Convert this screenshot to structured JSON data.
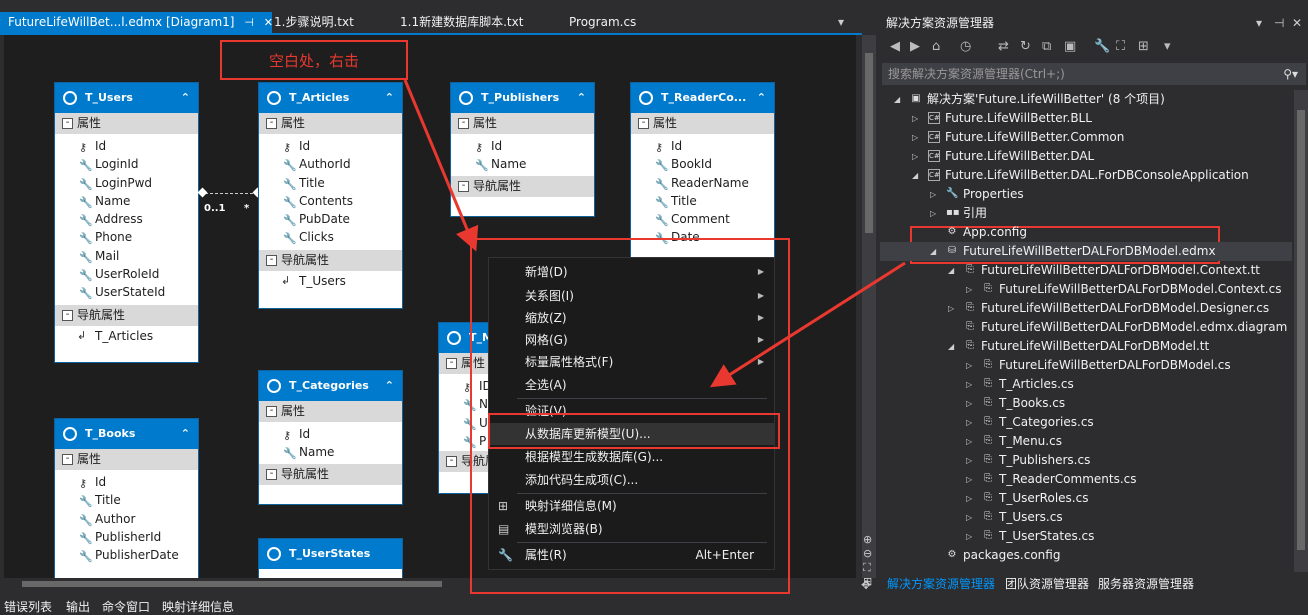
{
  "tabs": [
    {
      "label": "FutureLifeWillBet...l.edmx [Diagram1]",
      "active": true
    },
    {
      "label": "1.步骤说明.txt"
    },
    {
      "label": "1.1新建数据库脚本.txt"
    },
    {
      "label": "Program.cs"
    }
  ],
  "annotation": {
    "note": "空白处，右击"
  },
  "entities": {
    "users": {
      "title": "T_Users",
      "section_props": "属性",
      "section_nav": "导航属性",
      "props": [
        "Id",
        "LoginId",
        "LoginPwd",
        "Name",
        "Address",
        "Phone",
        "Mail",
        "UserRoleId",
        "UserStateId"
      ],
      "nav": [
        "T_Articles"
      ]
    },
    "articles": {
      "title": "T_Articles",
      "section_props": "属性",
      "section_nav": "导航属性",
      "props": [
        "Id",
        "AuthorId",
        "Title",
        "Contents",
        "PubDate",
        "Clicks"
      ],
      "nav": [
        "T_Users"
      ]
    },
    "publishers": {
      "title": "T_Publishers",
      "section_props": "属性",
      "section_nav": "导航属性",
      "props": [
        "Id",
        "Name"
      ]
    },
    "readercomments": {
      "title": "T_ReaderCo...",
      "section_props": "属性",
      "props": [
        "Id",
        "BookId",
        "ReaderName",
        "Title",
        "Comment",
        "Date"
      ]
    },
    "categories": {
      "title": "T_Categories",
      "section_props": "属性",
      "section_nav": "导航属性",
      "props": [
        "Id",
        "Name"
      ]
    },
    "books": {
      "title": "T_Books",
      "section_props": "属性",
      "props": [
        "Id",
        "Title",
        "Author",
        "PublisherId",
        "PublisherDate"
      ]
    },
    "userstates": {
      "title": "T_UserStates"
    },
    "menu": {
      "title": "T_M",
      "section_props": "属性",
      "section_nav": "导航属",
      "props": [
        "ID",
        "N",
        "U",
        "P"
      ]
    }
  },
  "association": {
    "left": "0..1",
    "right": "*"
  },
  "context_menu": {
    "items": [
      {
        "label": "新增(D)",
        "submenu": true
      },
      {
        "label": "关系图(I)",
        "submenu": true
      },
      {
        "label": "缩放(Z)",
        "submenu": true
      },
      {
        "label": "网格(G)",
        "submenu": true
      },
      {
        "label": "标量属性格式(F)",
        "submenu": true
      },
      {
        "label": "全选(A)"
      },
      {
        "label": "验证(V)"
      },
      {
        "label": "从数据库更新模型(U)...",
        "highlighted": true
      },
      {
        "label": "根据模型生成数据库(G)..."
      },
      {
        "label": "添加代码生成项(C)..."
      },
      {
        "label": "映射详细信息(M)",
        "icon": "mapping-icon"
      },
      {
        "label": "模型浏览器(B)",
        "icon": "model-browser-icon"
      },
      {
        "label": "属性(R)",
        "icon": "wrench-icon",
        "shortcut": "Alt+Enter"
      }
    ]
  },
  "solution_explorer": {
    "title": "解决方案资源管理器",
    "search_placeholder": "搜索解决方案资源管理器(Ctrl+;)",
    "tree": [
      {
        "label": "解决方案'Future.LifeWillBetter' (8 个项目)",
        "level": 0,
        "expand": "down"
      },
      {
        "label": "Future.LifeWillBetter.BLL",
        "level": 1,
        "expand": "right",
        "icon": "cs"
      },
      {
        "label": "Future.LifeWillBetter.Common",
        "level": 1,
        "expand": "right",
        "icon": "cs"
      },
      {
        "label": "Future.LifeWillBetter.DAL",
        "level": 1,
        "expand": "right",
        "icon": "cs"
      },
      {
        "label": "Future.LifeWillBetter.DAL.ForDBConsoleApplication",
        "level": 1,
        "expand": "down",
        "icon": "cs"
      },
      {
        "label": "Properties",
        "level": 2,
        "expand": "right",
        "icon": "wrench"
      },
      {
        "label": "引用",
        "level": 2,
        "expand": "right",
        "icon": "ref"
      },
      {
        "label": "App.config",
        "level": 2,
        "icon": "config"
      },
      {
        "label": "FutureLifeWillBetterDALForDBModel.edmx",
        "level": 2,
        "expand": "down",
        "icon": "edmx",
        "selected": true
      },
      {
        "label": "FutureLifeWillBetterDALForDBModel.Context.tt",
        "level": 3,
        "expand": "down",
        "icon": "file"
      },
      {
        "label": "FutureLifeWillBetterDALForDBModel.Context.cs",
        "level": 4,
        "expand": "right",
        "icon": "file"
      },
      {
        "label": "FutureLifeWillBetterDALForDBModel.Designer.cs",
        "level": 3,
        "expand": "right",
        "icon": "file"
      },
      {
        "label": "FutureLifeWillBetterDALForDBModel.edmx.diagram",
        "level": 3,
        "icon": "file"
      },
      {
        "label": "FutureLifeWillBetterDALForDBModel.tt",
        "level": 3,
        "expand": "down",
        "icon": "file"
      },
      {
        "label": "FutureLifeWillBetterDALForDBModel.cs",
        "level": 4,
        "expand": "right",
        "icon": "file"
      },
      {
        "label": "T_Articles.cs",
        "level": 4,
        "expand": "right",
        "icon": "file"
      },
      {
        "label": "T_Books.cs",
        "level": 4,
        "expand": "right",
        "icon": "file"
      },
      {
        "label": "T_Categories.cs",
        "level": 4,
        "expand": "right",
        "icon": "file"
      },
      {
        "label": "T_Menu.cs",
        "level": 4,
        "expand": "right",
        "icon": "file"
      },
      {
        "label": "T_Publishers.cs",
        "level": 4,
        "expand": "right",
        "icon": "file"
      },
      {
        "label": "T_ReaderComments.cs",
        "level": 4,
        "expand": "right",
        "icon": "file"
      },
      {
        "label": "T_UserRoles.cs",
        "level": 4,
        "expand": "right",
        "icon": "file"
      },
      {
        "label": "T_Users.cs",
        "level": 4,
        "expand": "right",
        "icon": "file"
      },
      {
        "label": "T_UserStates.cs",
        "level": 4,
        "expand": "right",
        "icon": "file"
      },
      {
        "label": "packages.config",
        "level": 2,
        "icon": "config"
      }
    ],
    "tabs": [
      "解决方案资源管理器",
      "团队资源管理器",
      "服务器资源管理器"
    ]
  },
  "bottom_tabs": [
    "错误列表",
    "输出",
    "命令窗口",
    "映射详细信息"
  ]
}
